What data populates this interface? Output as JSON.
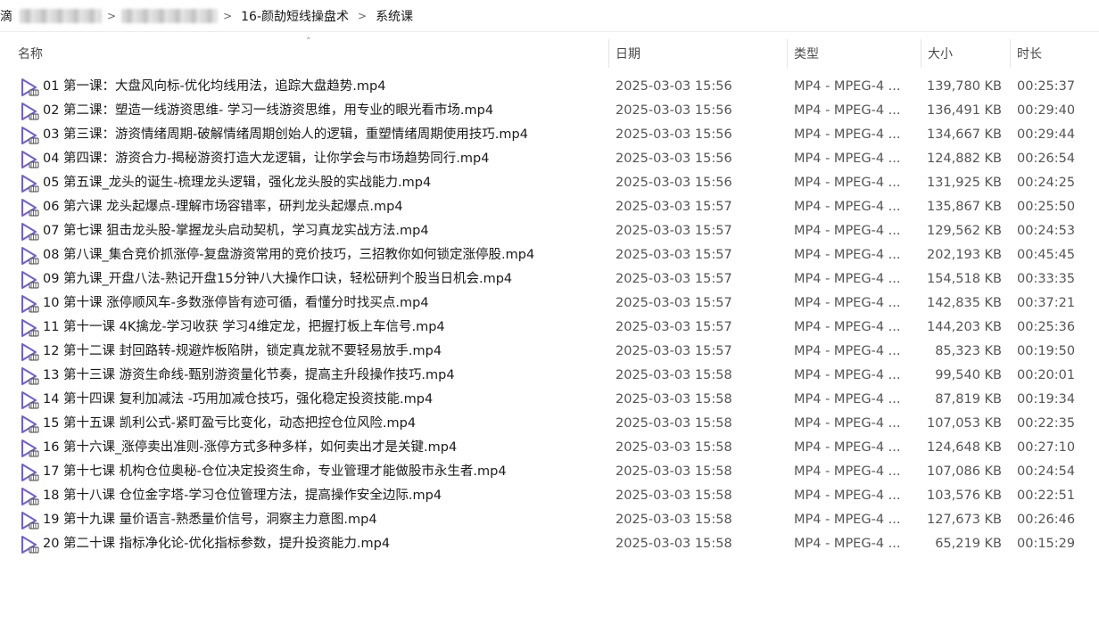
{
  "breadcrumb": {
    "root_fragment": "滴",
    "folder": "16-颜劼短线操盘术",
    "current": "系统课"
  },
  "columns": {
    "name": "名称",
    "date": "日期",
    "type": "类型",
    "size": "大小",
    "duration": "时长"
  },
  "files": [
    {
      "name": "01 第一课：大盘风向标-优化均线用法，追踪大盘趋势.mp4",
      "date": "2025-03-03 15:56",
      "type": "MP4 - MPEG-4 ...",
      "size": "139,780 KB",
      "duration": "00:25:37"
    },
    {
      "name": "02 第二课：塑造一线游资思维- 学习一线游资思维，用专业的眼光看市场.mp4",
      "date": "2025-03-03 15:56",
      "type": "MP4 - MPEG-4 ...",
      "size": "136,491 KB",
      "duration": "00:29:40"
    },
    {
      "name": "03 第三课：游资情绪周期-破解情绪周期创始人的逻辑，重塑情绪周期使用技巧.mp4",
      "date": "2025-03-03 15:56",
      "type": "MP4 - MPEG-4 ...",
      "size": "134,667 KB",
      "duration": "00:29:44"
    },
    {
      "name": "04 第四课：游资合力-揭秘游资打造大龙逻辑，让你学会与市场趋势同行.mp4",
      "date": "2025-03-03 15:56",
      "type": "MP4 - MPEG-4 ...",
      "size": "124,882 KB",
      "duration": "00:26:54"
    },
    {
      "name": "05 第五课_龙头的诞生-梳理龙头逻辑，强化龙头股的实战能力.mp4",
      "date": "2025-03-03 15:56",
      "type": "MP4 - MPEG-4 ...",
      "size": "131,925 KB",
      "duration": "00:24:25"
    },
    {
      "name": "06 第六课 龙头起爆点-理解市场容错率，研判龙头起爆点.mp4",
      "date": "2025-03-03 15:57",
      "type": "MP4 - MPEG-4 ...",
      "size": "135,867 KB",
      "duration": "00:25:50"
    },
    {
      "name": "07 第七课 狙击龙头股-掌握龙头启动契机，学习真龙实战方法.mp4",
      "date": "2025-03-03 15:57",
      "type": "MP4 - MPEG-4 ...",
      "size": "129,562 KB",
      "duration": "00:24:53"
    },
    {
      "name": "08 第八课_集合竞价抓涨停-复盘游资常用的竞价技巧，三招教你如何锁定涨停股.mp4",
      "date": "2025-03-03 15:57",
      "type": "MP4 - MPEG-4 ...",
      "size": "202,193 KB",
      "duration": "00:45:45"
    },
    {
      "name": "09 第九课_开盘八法-熟记开盘15分钟八大操作口诀，轻松研判个股当日机会.mp4",
      "date": "2025-03-03 15:57",
      "type": "MP4 - MPEG-4 ...",
      "size": "154,518 KB",
      "duration": "00:33:35"
    },
    {
      "name": "10 第十课 涨停顺风车-多数涨停皆有迹可循，看懂分时找买点.mp4",
      "date": "2025-03-03 15:57",
      "type": "MP4 - MPEG-4 ...",
      "size": "142,835 KB",
      "duration": "00:37:21"
    },
    {
      "name": "11 第十一课 4K擒龙-学习收获 学习4维定龙，把握打板上车信号.mp4",
      "date": "2025-03-03 15:57",
      "type": "MP4 - MPEG-4 ...",
      "size": "144,203 KB",
      "duration": "00:25:36"
    },
    {
      "name": "12 第十二课 封回路转-规避炸板陷阱，锁定真龙就不要轻易放手.mp4",
      "date": "2025-03-03 15:57",
      "type": "MP4 - MPEG-4 ...",
      "size": "85,323 KB",
      "duration": "00:19:50"
    },
    {
      "name": "13 第十三课 游资生命线-甄别游资量化节奏，提高主升段操作技巧.mp4",
      "date": "2025-03-03 15:58",
      "type": "MP4 - MPEG-4 ...",
      "size": "99,540 KB",
      "duration": "00:20:01"
    },
    {
      "name": "14 第十四课 复利加减法 -巧用加减仓技巧，强化稳定投资技能.mp4",
      "date": "2025-03-03 15:58",
      "type": "MP4 - MPEG-4 ...",
      "size": "87,819 KB",
      "duration": "00:19:34"
    },
    {
      "name": "15 第十五课 凯利公式-紧盯盈亏比变化，动态把控仓位风险.mp4",
      "date": "2025-03-03 15:58",
      "type": "MP4 - MPEG-4 ...",
      "size": "107,053 KB",
      "duration": "00:22:35"
    },
    {
      "name": "16 第十六课_涨停卖出准则-涨停方式多种多样，如何卖出才是关键.mp4",
      "date": "2025-03-03 15:58",
      "type": "MP4 - MPEG-4 ...",
      "size": "124,648 KB",
      "duration": "00:27:10"
    },
    {
      "name": "17 第十七课 机构仓位奥秘-仓位决定投资生命，专业管理才能做股市永生者.mp4",
      "date": "2025-03-03 15:58",
      "type": "MP4 - MPEG-4 ...",
      "size": "107,086 KB",
      "duration": "00:24:54"
    },
    {
      "name": "18 第十八课 仓位金字塔-学习仓位管理方法，提高操作安全边际.mp4",
      "date": "2025-03-03 15:58",
      "type": "MP4 - MPEG-4 ...",
      "size": "103,576 KB",
      "duration": "00:22:51"
    },
    {
      "name": "19 第十九课 量价语言-熟悉量价信号，洞察主力意图.mp4",
      "date": "2025-03-03 15:58",
      "type": "MP4 - MPEG-4 ...",
      "size": "127,673 KB",
      "duration": "00:26:46"
    },
    {
      "name": "20 第二十课 指标净化论-优化指标参数，提升投资能力.mp4",
      "date": "2025-03-03 15:58",
      "type": "MP4 - MPEG-4 ...",
      "size": "65,219 KB",
      "duration": "00:15:29"
    }
  ],
  "colors": {
    "icon_accent": "#6f5fd6",
    "icon_fill": "#ffffff",
    "text_primary": "#1a1a1a",
    "text_secondary": "#555555"
  }
}
